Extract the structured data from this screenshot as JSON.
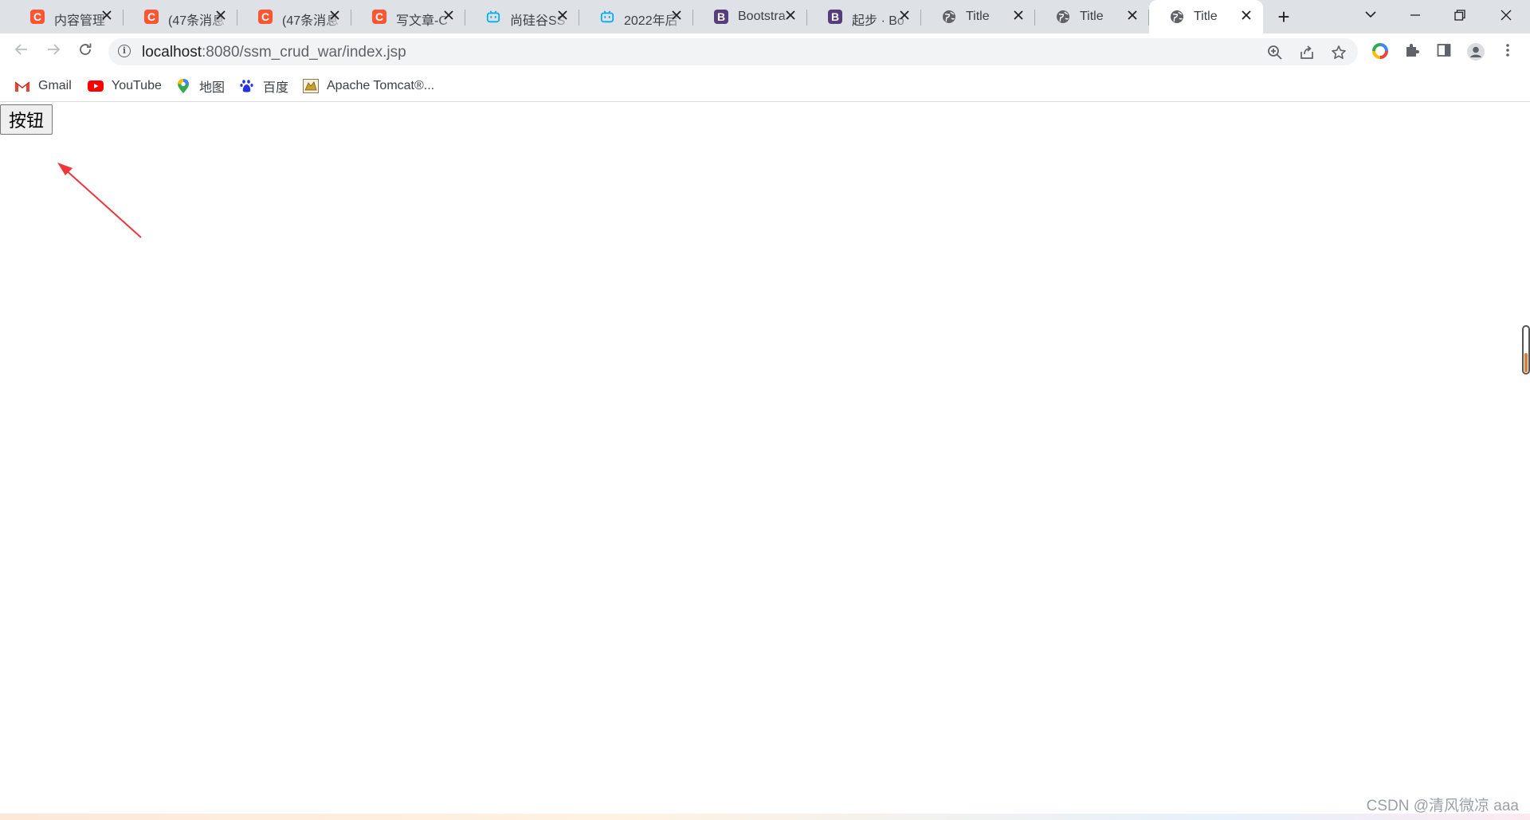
{
  "tabs": [
    {
      "title": "内容管理",
      "favicon": "csdn-icon",
      "favicon_text": "C",
      "color": "#fc5531"
    },
    {
      "title": "(47条消息",
      "favicon": "csdn-icon",
      "favicon_text": "C",
      "color": "#fc5531"
    },
    {
      "title": "(47条消息",
      "favicon": "csdn-icon",
      "favicon_text": "C",
      "color": "#fc5531"
    },
    {
      "title": "写文章-C",
      "favicon": "csdn-icon",
      "favicon_text": "C",
      "color": "#fc5531"
    },
    {
      "title": "尚硅谷SS",
      "favicon": "bilibili-icon",
      "favicon_text": "",
      "color": "#00aeec"
    },
    {
      "title": "2022年后",
      "favicon": "bilibili-icon",
      "favicon_text": "",
      "color": "#00aeec"
    },
    {
      "title": "Bootstra",
      "favicon": "bootstrap-icon",
      "favicon_text": "B",
      "color": "#563d7c"
    },
    {
      "title": "起步 · Bo",
      "favicon": "bootstrap-icon",
      "favicon_text": "B",
      "color": "#563d7c"
    },
    {
      "title": "Title",
      "favicon": "globe-icon",
      "favicon_text": "",
      "color": "#5f6368"
    },
    {
      "title": "Title",
      "favicon": "globe-icon",
      "favicon_text": "",
      "color": "#5f6368"
    },
    {
      "title": "Title",
      "favicon": "globe-icon",
      "favicon_text": "",
      "color": "#5f6368",
      "active": true
    }
  ],
  "address_bar": {
    "host": "localhost",
    "path": ":8080/ssm_crud_war/index.jsp"
  },
  "bookmarks": [
    {
      "label": "Gmail",
      "icon": "gmail-icon"
    },
    {
      "label": "YouTube",
      "icon": "youtube-icon"
    },
    {
      "label": "地图",
      "icon": "maps-icon"
    },
    {
      "label": "百度",
      "icon": "baidu-icon"
    },
    {
      "label": "Apache Tomcat®...",
      "icon": "tomcat-icon"
    }
  ],
  "page": {
    "button_label": "按钮"
  },
  "annotation": {
    "arrow_color": "#f0353a"
  },
  "watermark": "CSDN @清风微凉 aaa"
}
